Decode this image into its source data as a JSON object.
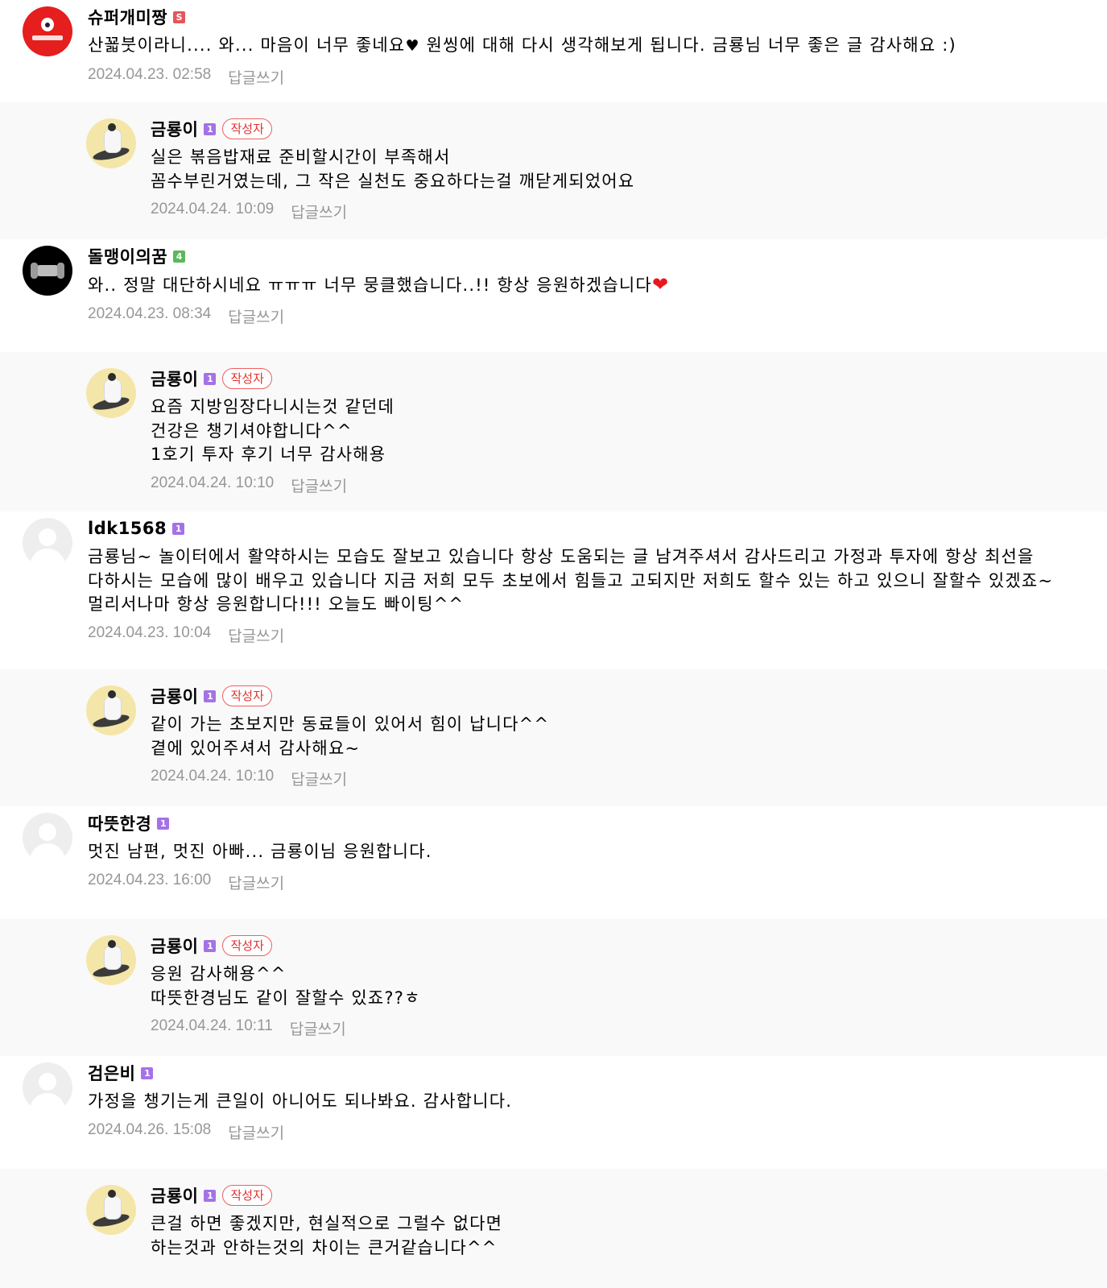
{
  "comments": [
    {
      "type": "top",
      "height": 127,
      "avatar": "supergaemi",
      "nickname": "슈퍼개미짱",
      "level": "S",
      "level_color": "#e4565b",
      "lines": [
        {
          "text": "산꾧붓이라니.... 와... 마음이 너무 좋네요"
        },
        {
          "text": " 원씽에 대해 다시 생각해보게 됩니다. 금룡님 너무 좋은 글 감사해요 :)"
        }
      ],
      "heart_after_first": "black",
      "date": "2024.04.23. 02:58",
      "reply": "답글쓰기"
    },
    {
      "type": "reply",
      "height": 170,
      "avatar": "geumryong",
      "nickname": "금룡이",
      "level": "1",
      "level_color": "#a572e6",
      "author_badge": "작성자",
      "text": "실은 볶음밥재료 준비할시간이 부족해서\n꼼수부린거였는데, 그 작은 실천도 중요하다는걸 깨닫게되었어요",
      "date": "2024.04.24. 10:09",
      "reply": "답글쓰기"
    },
    {
      "type": "top",
      "height": 140,
      "avatar": "dolmaeng",
      "nickname": "돌맹이의꿈",
      "level": "4",
      "level_color": "#5bb85d",
      "text": "와.. 정말 대단하시네요 ㅠㅠㅠ 너무 뭉클했습니다..!! 항상 응원하겠습니다",
      "heart_after": "red",
      "date": "2024.04.23. 08:34",
      "reply": "답글쓰기"
    },
    {
      "type": "reply",
      "height": 198,
      "avatar": "geumryong",
      "nickname": "금룡이",
      "level": "1",
      "level_color": "#a572e6",
      "author_badge": "작성자",
      "text": "요즘 지방임장다니시는것 같던데\n건강은 챙기셔야합니다^^\n1호기 투자 후기 너무 감사해용",
      "date": "2024.04.24. 10:10",
      "reply": "답글쓰기"
    },
    {
      "type": "top",
      "height": 196,
      "avatar": "default",
      "nickname": "ldk1568",
      "level": "1",
      "level_color": "#a572e6",
      "text": "금룡님~ 놀이터에서 활약하시는 모습도 잘보고 있습니다 항상 도움되는 글 남겨주셔서 감사드리고 가정과 투자에 항상 최선을 다하시는 모습에 많이 배우고 있습니다 지금 저희 모두 초보에서 힘들고 고되지만 저희도 할수 있는 하고 있으니 잘할수 있겠죠~ 멀리서나마 항상 응원합니다!!! 오늘도 빠이팅^^",
      "date": "2024.04.23. 10:04",
      "reply": "답글쓰기"
    },
    {
      "type": "reply",
      "height": 170,
      "avatar": "geumryong",
      "nickname": "금룡이",
      "level": "1",
      "level_color": "#a572e6",
      "author_badge": "작성자",
      "text": "같이 가는 초보지만 동료들이 있어서 힘이 납니다^^\n곁에 있어주셔서 감사해요~",
      "date": "2024.04.24. 10:10",
      "reply": "답글쓰기"
    },
    {
      "type": "top",
      "height": 140,
      "avatar": "default",
      "nickname": "따뜻한경",
      "level": "1",
      "level_color": "#a572e6",
      "text": "멋진 남편, 멋진 아빠... 금룡이님 응원합니다.",
      "date": "2024.04.23. 16:00",
      "reply": "답글쓰기"
    },
    {
      "type": "reply",
      "height": 170,
      "avatar": "geumryong",
      "nickname": "금룡이",
      "level": "1",
      "level_color": "#a572e6",
      "author_badge": "작성자",
      "text": "응원 감사해용^^\n따뜻한경님도 같이 잘할수 있죠??ㅎ",
      "date": "2024.04.24. 10:11",
      "reply": "답글쓰기"
    },
    {
      "type": "top",
      "height": 140,
      "avatar": "default",
      "nickname": "검은비",
      "level": "1",
      "level_color": "#a572e6",
      "text": "가정을 챙기는게 큰일이 아니어도 되나봐요. 감사합니다.",
      "date": "2024.04.26. 15:08",
      "reply": "답글쓰기"
    },
    {
      "type": "reply",
      "height": 148,
      "avatar": "geumryong",
      "nickname": "금룡이",
      "level": "1",
      "level_color": "#a572e6",
      "author_badge": "작성자",
      "text": "큰걸 하면 좋겠지만, 현실적으로 그럴수 없다면\n하는것과 안하는것의 차이는 큰거같습니다^^"
    }
  ]
}
